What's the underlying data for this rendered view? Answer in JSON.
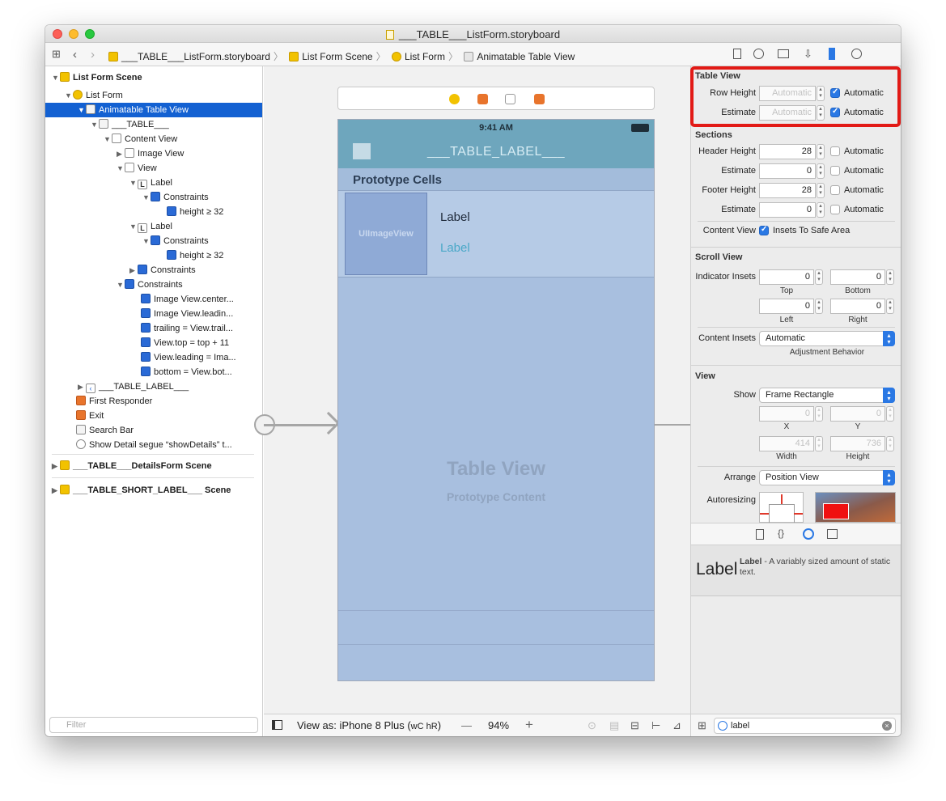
{
  "window": {
    "title": "___TABLE___ListForm.storyboard"
  },
  "jumpbar": {
    "items": [
      "___TABLE___ListForm.storyboard",
      "List Form Scene",
      "List Form",
      "Animatable Table View"
    ]
  },
  "outline": {
    "rows": [
      {
        "label": "List Form Scene",
        "icon": "scene-icon"
      },
      {
        "label": "List Form",
        "icon": "view-controller-icon"
      },
      {
        "label": "Animatable Table View",
        "icon": "table-view-icon"
      },
      {
        "label": "___TABLE___",
        "icon": "table-cell-icon"
      },
      {
        "label": "Content View",
        "icon": "view-icon"
      },
      {
        "label": "Image View",
        "icon": "image-view-icon"
      },
      {
        "label": "View",
        "icon": "view-icon"
      },
      {
        "label": "Label",
        "icon": "label-icon"
      },
      {
        "label": "Constraints",
        "icon": "constraints-icon"
      },
      {
        "label": "height ≥ 32",
        "icon": "constraint-icon"
      },
      {
        "label": "Label",
        "icon": "label-icon"
      },
      {
        "label": "Constraints",
        "icon": "constraints-icon"
      },
      {
        "label": "height ≥ 32",
        "icon": "constraint-icon"
      },
      {
        "label": "Constraints",
        "icon": "constraints-icon"
      },
      {
        "label": "Constraints",
        "icon": "constraints-icon"
      },
      {
        "label": "Image View.center...",
        "icon": "constraint-icon"
      },
      {
        "label": "Image View.leadin...",
        "icon": "constraint-icon"
      },
      {
        "label": "trailing = View.trail...",
        "icon": "constraint-icon"
      },
      {
        "label": "View.top = top + 11",
        "icon": "constraint-icon"
      },
      {
        "label": "View.leading = Ima...",
        "icon": "constraint-icon"
      },
      {
        "label": "bottom = View.bot...",
        "icon": "constraint-icon"
      },
      {
        "label": "___TABLE_LABEL___",
        "icon": "navigation-item-icon"
      },
      {
        "label": "First Responder",
        "icon": "first-responder-icon"
      },
      {
        "label": "Exit",
        "icon": "exit-icon"
      },
      {
        "label": "Search Bar",
        "icon": "search-bar-icon"
      },
      {
        "label": "Show Detail segue “showDetails” t...",
        "icon": "segue-icon"
      },
      {
        "label": "___TABLE___DetailsForm Scene",
        "icon": "scene-icon"
      },
      {
        "label": "___TABLE_SHORT_LABEL___ Scene",
        "icon": "scene-icon"
      }
    ],
    "filter_placeholder": "Filter"
  },
  "canvas": {
    "status_time": "9:41 AM",
    "nav_title": "___TABLE_LABEL___",
    "prototype_header": "Prototype Cells",
    "image_view_label": "UIImageView",
    "cell_label_1": "Label",
    "cell_label_2": "Label",
    "table_view_label": "Table View",
    "table_view_sub": "Prototype Content",
    "view_as": "View as: iPhone 8 Plus (",
    "view_as_size": "wC hR",
    "view_as_end": ")",
    "zoom_minus": "—",
    "zoom": "94%",
    "zoom_plus": "+"
  },
  "inspector": {
    "table_view": {
      "header": "Table View",
      "row_height_label": "Row Height",
      "row_height_value": "Automatic",
      "row_height_auto": "Automatic",
      "estimate_label": "Estimate",
      "estimate_value": "Automatic",
      "estimate_auto": "Automatic"
    },
    "sections": {
      "header": "Sections",
      "header_height_label": "Header Height",
      "header_height_value": "28",
      "header_estimate_label": "Estimate",
      "header_estimate_value": "0",
      "footer_height_label": "Footer Height",
      "footer_height_value": "28",
      "footer_estimate_label": "Estimate",
      "footer_estimate_value": "0",
      "automatic": "Automatic",
      "content_view_label": "Content View",
      "insets_to_safe_area": "Insets To Safe Area"
    },
    "scroll_view": {
      "header": "Scroll View",
      "indicator_insets_label": "Indicator Insets",
      "top": "0",
      "bottom": "0",
      "left": "0",
      "right": "0",
      "top_label": "Top",
      "bottom_label": "Bottom",
      "left_label": "Left",
      "right_label": "Right",
      "content_insets_label": "Content Insets",
      "content_insets_value": "Automatic",
      "adjustment_behavior": "Adjustment Behavior"
    },
    "view": {
      "header": "View",
      "show_label": "Show",
      "show_value": "Frame Rectangle",
      "x": "0",
      "y": "0",
      "x_label": "X",
      "y_label": "Y",
      "width": "414",
      "height": "736",
      "width_label": "Width",
      "height_label": "Height",
      "arrange_label": "Arrange",
      "arrange_value": "Position View",
      "autoresizing_label": "Autoresizing"
    }
  },
  "library": {
    "item_title": "Label",
    "item_name": "Label",
    "item_desc": " - A variably sized amount of static text.",
    "search_value": "label"
  },
  "colors": {
    "selection": "#1361d2",
    "checkbox": "#2a78e4",
    "highlight_box": "#e21a16",
    "nav_bar": "#6ea6bd",
    "table_bg": "#a8bfdf"
  }
}
